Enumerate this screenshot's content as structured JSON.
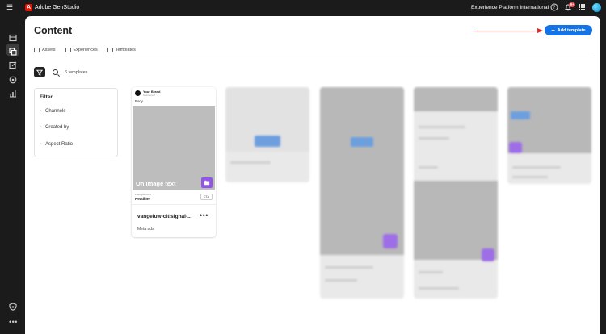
{
  "topbar": {
    "app_name": "Adobe GenStudio",
    "org_name": "Experience Platform International",
    "notification_count": "9+",
    "icons": [
      "menu-icon",
      "adobe-logo-icon",
      "help-icon",
      "bell-icon",
      "apps-grid-icon",
      "avatar"
    ]
  },
  "rail": {
    "items": [
      "home-icon",
      "content-icon",
      "create-icon",
      "insights-icon",
      "analytics-icon",
      "shield-icon",
      "more-icon"
    ],
    "more_label": "•••"
  },
  "page": {
    "title": "Content",
    "add_template_label": "Add template",
    "annotation_color": "#e02c20",
    "accent_color": "#1473e6"
  },
  "tabs": [
    {
      "label": "Assets",
      "active": false
    },
    {
      "label": "Experiences",
      "active": false
    },
    {
      "label": "Templates",
      "active": true
    }
  ],
  "toolbar": {
    "template_count": "6 templates"
  },
  "filter": {
    "title": "Filter",
    "sections": [
      "Channels",
      "Created by",
      "Aspect Ratio"
    ]
  },
  "template_card": {
    "brand_name": "Your Brand",
    "brand_sub": "Sponsored",
    "body_label": "Body",
    "image_text": "On Image text",
    "url": "example.com",
    "headline": "Headline",
    "cta": "CTA",
    "name": "vangeluw-citisignal-...",
    "channel": "Meta ads"
  }
}
